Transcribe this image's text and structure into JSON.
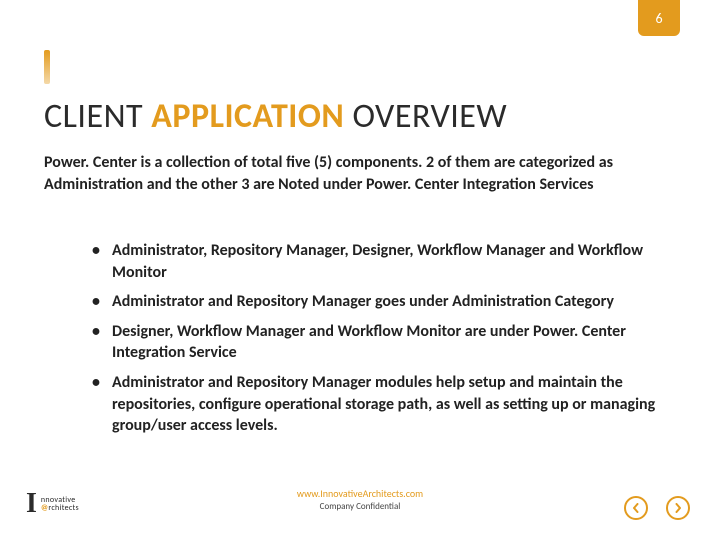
{
  "page_number": "6",
  "title": {
    "part1": "CLIENT ",
    "accent": "APPLICATION",
    "part3": " OVERVIEW"
  },
  "intro": "Power. Center is a collection of total five (5) components. 2 of them are categorized as Administration and the other 3 are Noted under Power. Center Integration Services",
  "bullets": [
    "Administrator, Repository Manager, Designer, Workflow Manager and Workflow Monitor",
    "Administrator and Repository Manager goes under Administration Category",
    "Designer, Workflow Manager and Workflow Monitor are under Power. Center Integration Service",
    "Administrator and Repository Manager modules help setup and maintain the repositories, configure operational storage path, as well as setting up or managing group/user access levels."
  ],
  "footer": {
    "link": "www.InnovativeArchitects.com",
    "confidential": "Company Confidential"
  },
  "logo": {
    "mark": "I",
    "line1_a": "nnovative",
    "at": "@",
    "line2_b": "rchitects"
  },
  "colors": {
    "accent": "#e39b1e"
  }
}
